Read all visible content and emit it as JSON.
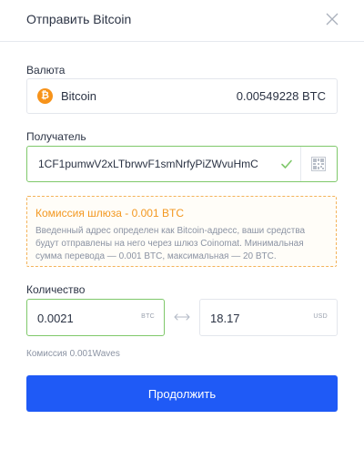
{
  "dialog": {
    "title": "Отправить Bitcoin"
  },
  "currency": {
    "label": "Валюта",
    "icon": "bitcoin-icon",
    "icon_glyph": "₿",
    "icon_color": "#f7931a",
    "name": "Bitcoin",
    "balance": "0.00549228 BTC"
  },
  "recipient": {
    "label": "Получатель",
    "address": "1CF1pumwV2xLTbrwvF1smNrfyPiZWvuHmC",
    "valid": true
  },
  "gateway_notice": {
    "title": "Комиссия шлюза - 0.001 BTC",
    "text": "Введенный адрес определен как Bitcoin-адресс, ваши средства будут отправлены на него через шлюз Coinomat. Минимальная сумма перевода — 0.001 BTC, максимальная — 20 BTC."
  },
  "amount": {
    "label": "Количество",
    "crypto_value": "0.0021",
    "crypto_unit": "BTC",
    "fiat_value": "18.17",
    "fiat_unit": "USD"
  },
  "fee": {
    "text": "Комиссия 0.001Waves"
  },
  "actions": {
    "continue_label": "Продолжить"
  },
  "colors": {
    "accent": "#1f5af6",
    "valid": "#7fc86a",
    "warning": "#f39821",
    "bitcoin": "#f7931a"
  }
}
